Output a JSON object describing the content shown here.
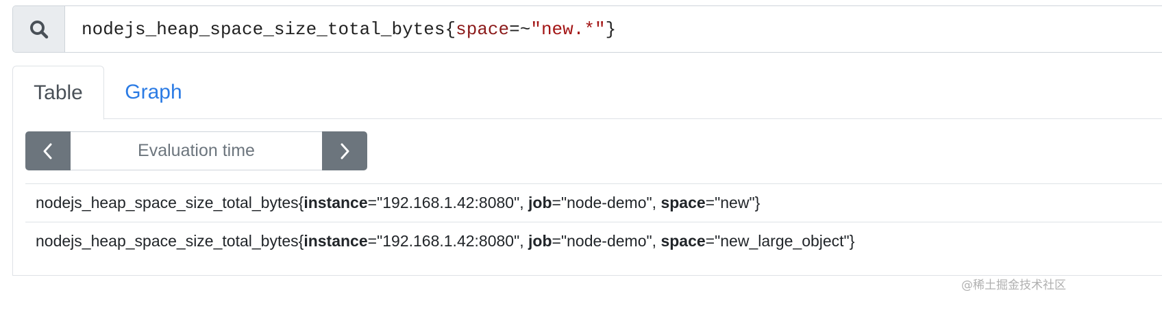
{
  "query": {
    "metric": "nodejs_heap_space_size_total_bytes",
    "open_brace": "{",
    "label": "space",
    "operator": "=~",
    "value": "\"new.*\"",
    "close_brace": "}"
  },
  "tabs": [
    {
      "label": "Table",
      "active": true
    },
    {
      "label": "Graph",
      "active": false
    }
  ],
  "eval": {
    "placeholder": "Evaluation time",
    "prev_icon": "chevron-left-icon",
    "next_icon": "chevron-right-icon"
  },
  "results": [
    {
      "metric": "nodejs_heap_space_size_total_bytes{",
      "k1": "instance",
      "v1": "=\"192.168.1.42:8080\", ",
      "k2": "job",
      "v2": "=\"node-demo\", ",
      "k3": "space",
      "v3": "=\"new\"}"
    },
    {
      "metric": "nodejs_heap_space_size_total_bytes{",
      "k1": "instance",
      "v1": "=\"192.168.1.42:8080\", ",
      "k2": "job",
      "v2": "=\"node-demo\", ",
      "k3": "space",
      "v3": "=\"new_large_object\"}"
    }
  ],
  "watermark": "@稀土掘金技术社区",
  "colors": {
    "accent_link": "#2b7be4",
    "button_gray": "#6c757d",
    "query_label": "#8b1a1a",
    "query_string": "#a31515"
  }
}
